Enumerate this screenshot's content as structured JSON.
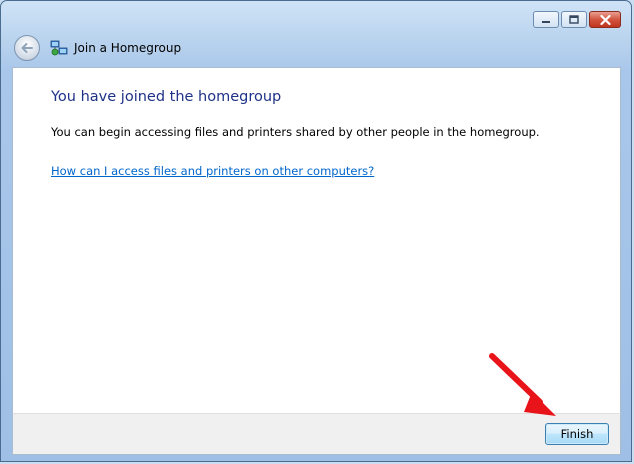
{
  "window": {
    "title": "Join a Homegroup",
    "controls": [
      "minimize-icon",
      "maximize-icon",
      "close-icon"
    ]
  },
  "icons": {
    "back": "back-arrow-icon",
    "app": "homegroup-icon",
    "annotation": "red-arrow-icon"
  },
  "content": {
    "heading": "You have joined the homegroup",
    "body": "You can begin accessing files and printers shared by other people in the homegroup.",
    "help_link": "How can I access files and printers on other computers?"
  },
  "footer": {
    "finish_label": "Finish"
  },
  "colors": {
    "heading": "#1e3287",
    "link": "#0066cc",
    "annotation_arrow": "#e8141a"
  }
}
